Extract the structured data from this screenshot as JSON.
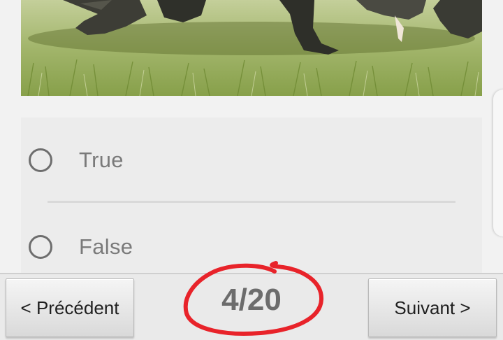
{
  "question": {
    "image_alt": "Komodo dragon on grass"
  },
  "options": [
    {
      "label": "True",
      "selected": false
    },
    {
      "label": "False",
      "selected": false
    }
  ],
  "navigation": {
    "prev_label": "< Précédent",
    "next_label": "Suivant >",
    "counter": "4/20",
    "current": 4,
    "total": 20
  },
  "colors": {
    "circle_annotation": "#e8232a",
    "counter_text": "#6c6c6c",
    "option_text": "#7a7a7a"
  }
}
